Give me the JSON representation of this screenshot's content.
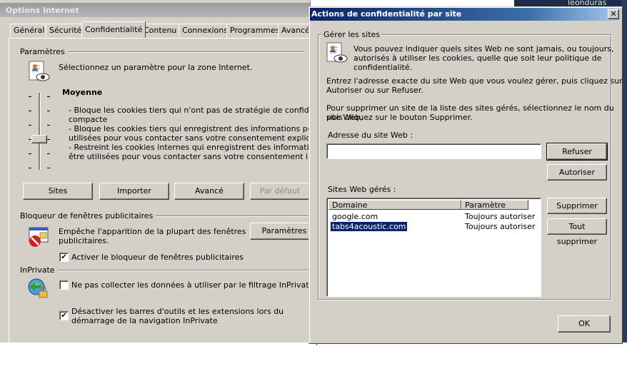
{
  "background_window": {
    "title": "Options Internet",
    "tabs": [
      "Général",
      "Sécurité",
      "Confidentialité",
      "Contenu",
      "Connexions",
      "Programmes",
      "Avancé"
    ],
    "active_tab": "Confidentialité",
    "parametres": {
      "section_label": "Paramètres",
      "description": "Sélectionnez un paramètre pour la zone Internet.",
      "level": "Moyenne",
      "level_details": [
        "- Bloque les cookies tiers qui n'ont pas de stratégie de confidentialité",
        "compacte",
        "- Bloque les cookies tiers qui enregistrent des informations pouvant êt",
        "utilisées pour vous contacter sans votre consentement explicite",
        "- Restreint les cookies internes qui enregistrent des informations pouv",
        "être utilisées pour vous contacter sans votre consentement implicite"
      ],
      "buttons": {
        "sites": "Sites",
        "importer": "Importer",
        "avance": "Avancé",
        "par_defaut": "Par défaut"
      }
    },
    "popup_blocker": {
      "section_label": "Bloqueur de fenêtres publicitaires",
      "description_line1": "Empêche l'apparition de la plupart des fenêtres",
      "description_line2": "publicitaires.",
      "settings_button": "Paramètres",
      "enable_checkbox_label": "Activer le bloqueur de fenêtres publicitaires",
      "enable_checked": true
    },
    "inprivate": {
      "section_label": "InPrivate",
      "filter_checkbox_label": "Ne pas collecter les données à utiliser par le filtrage InPrivate",
      "filter_checked": false,
      "disable_toolbars_line1": "Désactiver les barres d'outils et les extensions lors du",
      "disable_toolbars_line2": "démarrage de la navigation InPrivate",
      "disable_toolbars_checked": true
    }
  },
  "dialog": {
    "title": "Actions de confidentialité par site",
    "close_glyph": "✕",
    "group_label": "Gérer les sites",
    "intro_line1": "Vous pouvez indiquer quels sites Web ne sont jamais, ou toujours,",
    "intro_line2": "autorisés à utiliser les cookies, quelle que soit leur politique de",
    "intro_line3": "confidentialité.",
    "instr1_line1": "Entrez l'adresse exacte du site Web que vous voulez gérer, puis cliquez sur",
    "instr1_line2": "Autoriser ou sur Refuser.",
    "instr2_line1": "Pour supprimer un site de la liste des sites gérés, sélectionnez le nom du site Web,",
    "instr2_line2": "puis cliquez sur le bouton Supprimer.",
    "address_label": "Adresse du site Web :",
    "address_value": "",
    "buttons": {
      "refuser": "Refuser",
      "autoriser": "Autoriser",
      "supprimer": "Supprimer",
      "tout_supprimer": "Tout supprimer",
      "ok": "OK"
    },
    "managed_label": "Sites Web gérés :",
    "columns": [
      "Domaine",
      "Paramètre"
    ],
    "sites": [
      {
        "domain": "google.com",
        "setting": "Toujours autoriser",
        "selected": false
      },
      {
        "domain": "tabs4acoustic.com",
        "setting": "Toujours autoriser",
        "selected": true
      }
    ]
  },
  "desktop": {
    "partial_name": "leonduras"
  }
}
